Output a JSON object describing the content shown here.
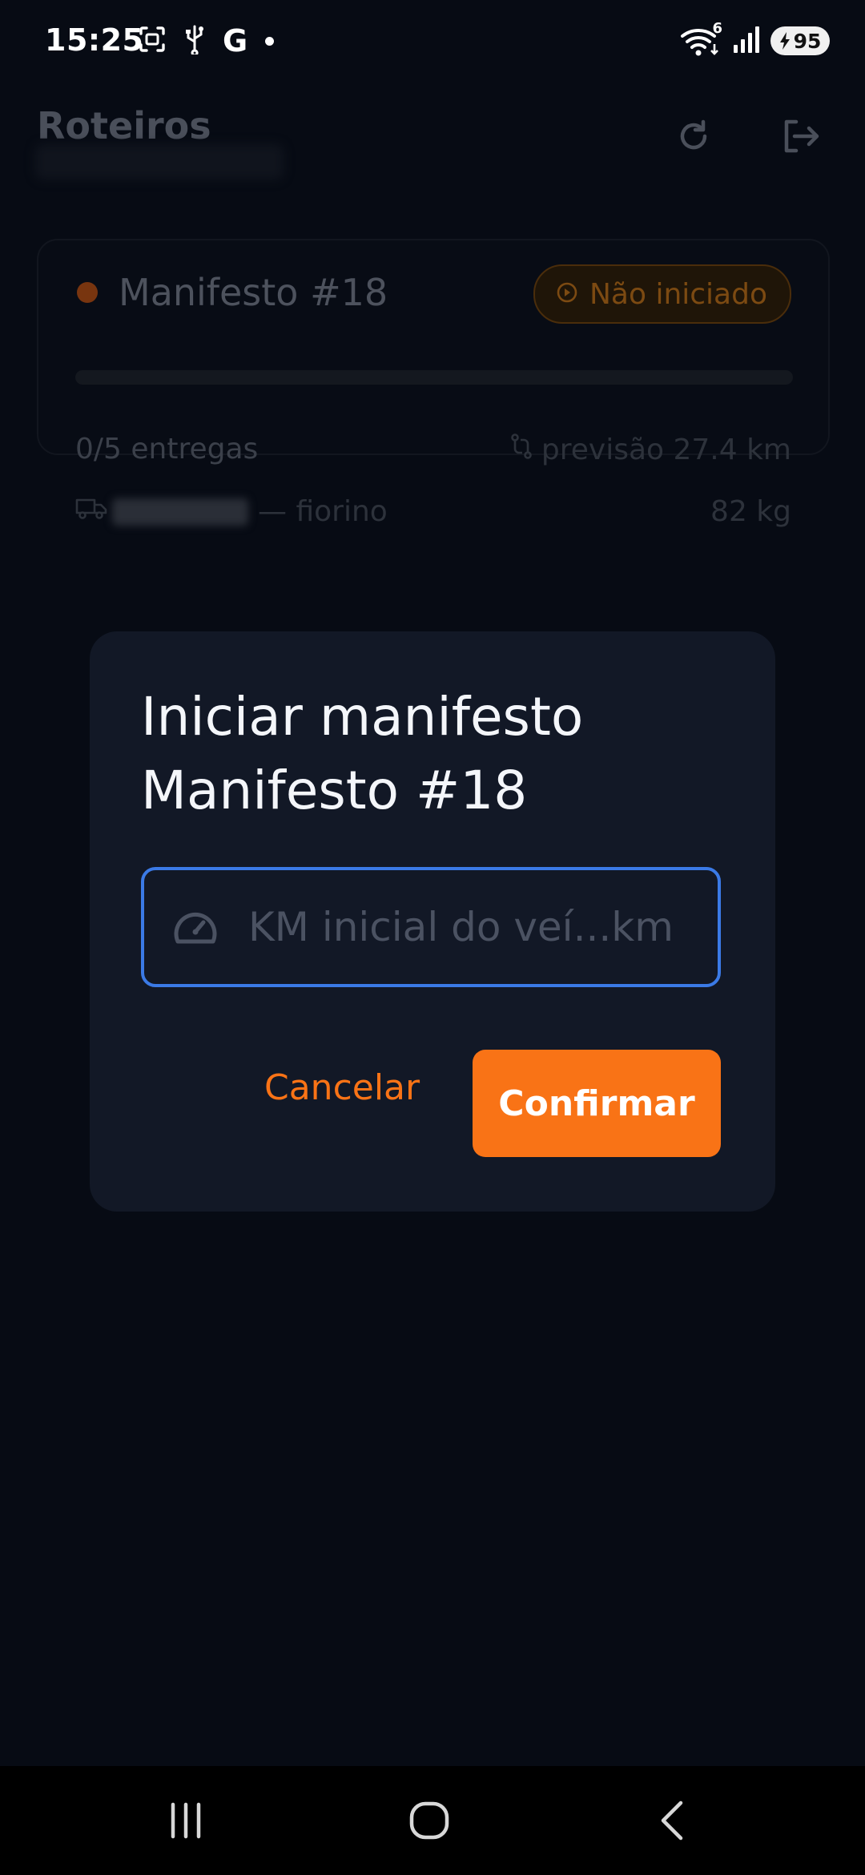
{
  "status_bar": {
    "time": "15:25",
    "g_label": "G",
    "wifi_badge": "6",
    "battery": "95",
    "icons": [
      "screenshot-icon",
      "usb-icon",
      "google-icon",
      "notification-dot-icon",
      "wifi-icon",
      "signal-icon",
      "battery-charging-icon"
    ]
  },
  "header": {
    "title": "Roteiros",
    "actions": [
      "refresh-icon",
      "logout-icon"
    ]
  },
  "manifest_card": {
    "title": "Manifesto #18",
    "status": "Não iniciado",
    "progress": 0,
    "deliveries": "0/5 entregas",
    "forecast": "previsão 27.4 km",
    "vehicle_suffix": "— fiorino",
    "weight": "82 kg"
  },
  "dialog": {
    "title_line1": "Iniciar manifesto",
    "title_line2": "Manifesto #18",
    "km_placeholder": "KM inicial do veí...km",
    "km_value": "",
    "cancel_label": "Cancelar",
    "confirm_label": "Confirmar"
  },
  "colors": {
    "accent": "#f97316",
    "focus_border": "#3b7ae6",
    "dialog_bg": "#121826",
    "page_bg": "#070b14"
  },
  "nav_bar": {
    "buttons": [
      "recent-apps-icon",
      "home-icon",
      "back-icon"
    ]
  }
}
